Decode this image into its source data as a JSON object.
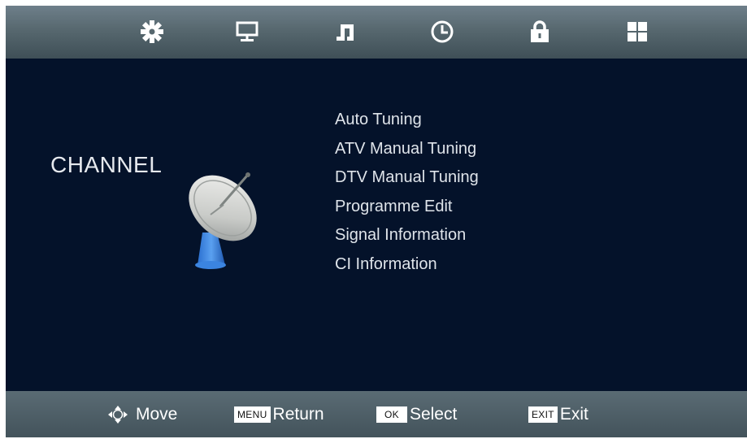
{
  "tabs": [
    {
      "name": "picture",
      "icon": "gear-icon"
    },
    {
      "name": "display",
      "icon": "monitor-icon"
    },
    {
      "name": "sound",
      "icon": "music-note-icon"
    },
    {
      "name": "time",
      "icon": "clock-icon"
    },
    {
      "name": "lock",
      "icon": "lock-icon"
    },
    {
      "name": "setup",
      "icon": "grid-icon"
    }
  ],
  "section": {
    "title": "CHANNEL",
    "icon": "satellite-dish-icon"
  },
  "menu": {
    "items": [
      {
        "label": "Auto Tuning"
      },
      {
        "label": "ATV Manual Tuning"
      },
      {
        "label": "DTV Manual Tuning"
      },
      {
        "label": "Programme Edit"
      },
      {
        "label": "Signal Information"
      },
      {
        "label": "CI Information"
      }
    ]
  },
  "footer": {
    "move": {
      "icon": "dpad-arrows-icon",
      "label": "Move"
    },
    "return": {
      "key": "MENU",
      "label": "Return"
    },
    "select": {
      "key": "OK",
      "label": "Select"
    },
    "exit": {
      "key": "EXIT",
      "label": "Exit"
    }
  },
  "colors": {
    "background": "#04122a",
    "bar": "#57686f",
    "text": "#dfe4ea"
  }
}
